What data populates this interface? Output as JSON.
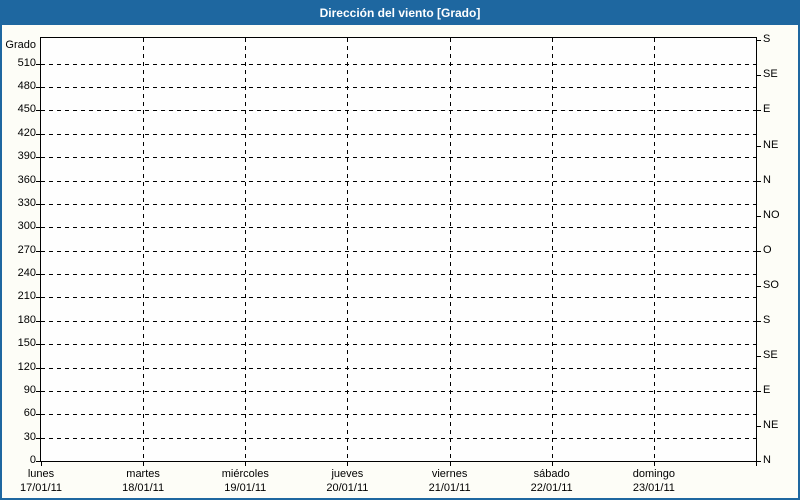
{
  "colors": {
    "titlebar": "#1E67A0",
    "frame_border": "#1E67A0",
    "title_text": "#FFFFFF",
    "grid": "#000000",
    "axis_text": "#000000",
    "plot_bg": "#FEFEFE",
    "page_bg": "#FDFDF7"
  },
  "chart_data": {
    "type": "line",
    "title": "Dirección del viento [Grado]",
    "y_axis_left": {
      "label": "Grado",
      "min": 0,
      "max": 540,
      "tick_step": 30,
      "ticks": [
        510,
        480,
        450,
        420,
        390,
        360,
        330,
        300,
        270,
        240,
        210,
        180,
        150,
        120,
        90,
        60,
        30,
        0
      ]
    },
    "y_axis_right": {
      "ticks": [
        {
          "deg": 540,
          "label": "S"
        },
        {
          "deg": 495,
          "label": "SE"
        },
        {
          "deg": 450,
          "label": "E"
        },
        {
          "deg": 405,
          "label": "NE"
        },
        {
          "deg": 360,
          "label": "N"
        },
        {
          "deg": 315,
          "label": "NO"
        },
        {
          "deg": 270,
          "label": "O"
        },
        {
          "deg": 225,
          "label": "SO"
        },
        {
          "deg": 180,
          "label": "S"
        },
        {
          "deg": 135,
          "label": "SE"
        },
        {
          "deg": 90,
          "label": "E"
        },
        {
          "deg": 45,
          "label": "NE"
        },
        {
          "deg": 0,
          "label": "N"
        }
      ]
    },
    "x_axis": {
      "days": [
        {
          "name": "lunes",
          "date": "17/01/11"
        },
        {
          "name": "martes",
          "date": "18/01/11"
        },
        {
          "name": "miércoles",
          "date": "19/01/11"
        },
        {
          "name": "jueves",
          "date": "20/01/11"
        },
        {
          "name": "viernes",
          "date": "21/01/11"
        },
        {
          "name": "sábado",
          "date": "22/01/11"
        },
        {
          "name": "domingo",
          "date": "23/01/11"
        }
      ]
    },
    "grid": {
      "horizontal_dashed": true,
      "vertical_dashed": true,
      "style": "dashed"
    },
    "series": []
  }
}
